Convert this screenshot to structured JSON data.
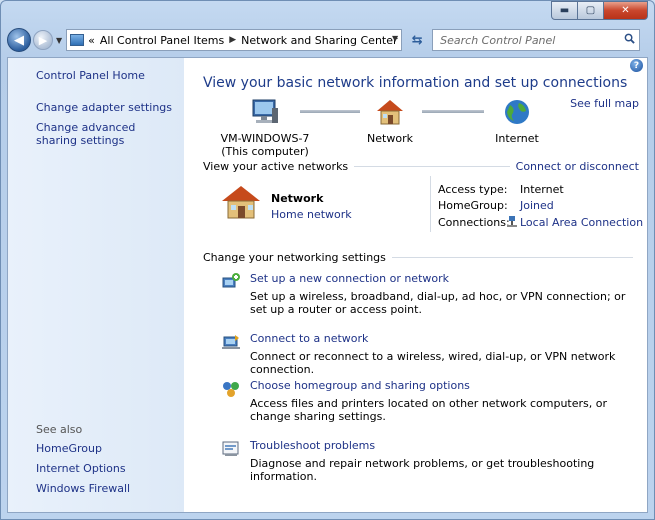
{
  "nav": {
    "address_prefix": "«",
    "crumb_1": "All Control Panel Items",
    "crumb_2": "Network and Sharing Center",
    "search_placeholder": "Search Control Panel"
  },
  "sidebar": {
    "home": "Control Panel Home",
    "items": [
      "Change adapter settings",
      "Change advanced sharing settings"
    ],
    "see_also": "See also",
    "see_also_items": [
      "HomeGroup",
      "Internet Options",
      "Windows Firewall"
    ]
  },
  "main": {
    "title": "View your basic network information and set up connections",
    "see_full_map": "See full map",
    "nodes": {
      "computer": "VM-WINDOWS-7",
      "computer_sub": "(This computer)",
      "network": "Network",
      "internet": "Internet"
    },
    "active_networks_heading": "View your active networks",
    "connect_disconnect": "Connect or disconnect",
    "active_network": {
      "name": "Network",
      "type": "Home network",
      "access_type_label": "Access type:",
      "access_type_value": "Internet",
      "homegroup_label": "HomeGroup:",
      "homegroup_value": "Joined",
      "connections_label": "Connections:",
      "connections_value": "Local Area Connection"
    },
    "change_settings_heading": "Change your networking settings",
    "tasks": [
      {
        "title": "Set up a new connection or network",
        "desc": "Set up a wireless, broadband, dial-up, ad hoc, or VPN connection; or set up a router or access point."
      },
      {
        "title": "Connect to a network",
        "desc": "Connect or reconnect to a wireless, wired, dial-up, or VPN network connection."
      },
      {
        "title": "Choose homegroup and sharing options",
        "desc": "Access files and printers located on other network computers, or change sharing settings."
      },
      {
        "title": "Troubleshoot problems",
        "desc": "Diagnose and repair network problems, or get troubleshooting information."
      }
    ]
  },
  "colors": {
    "link": "#1e3287",
    "title": "#1e3c8a"
  }
}
